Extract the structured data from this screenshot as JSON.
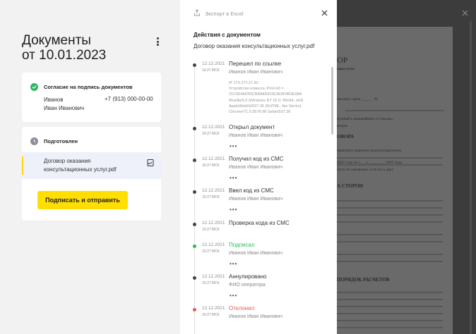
{
  "left": {
    "title_line1": "Документы",
    "title_line2": "от 10.01.2023",
    "agreement_card": {
      "title": "Согласие на подпись документов",
      "signer_last": "Иванов",
      "signer_first": "Иван Иванович",
      "phone": "+7 (913) 000-00-00"
    },
    "prepared_card": {
      "title": "Подготовлен",
      "file_name": "Договор оказания консультационных услуг.pdf",
      "sign_button": "Подписать и отправить"
    }
  },
  "panel": {
    "export_label": "Экспорт в Excel",
    "section_title": "Действия с документом",
    "document_name": "Договор оказания консультационных услуг.pdf",
    "events": [
      {
        "date": "12.12.2021",
        "time": "16:27 МСК",
        "name": "Перешел по ссылке",
        "who": "Иванов Иван Иванович",
        "color": "#444444",
        "meta": [
          "IP 173.272.27.82",
          "Устройство клиента: Print A3 =",
          "21C904AD55CB8A8A922E3E8F8B3E98A",
          "Mozilla/5.0 (Windows NT 10.0; Win64; x64)",
          "AppleWebKit/537.36 (KHTML, like Gecko)",
          "Chrome/71.0.3578.98 Safari/537.36"
        ]
      },
      {
        "date": "12.12.2021",
        "time": "16:27 МСК",
        "name": "Открыл документ",
        "who": "Иванов Иван Иванович",
        "color": "#444444",
        "more": "•••"
      },
      {
        "date": "12.12.2021",
        "time": "16:27 МСК",
        "name": "Получил код из СМС",
        "who": "Иванов Иван Иванович",
        "color": "#444444",
        "more": "•••"
      },
      {
        "date": "12.12.2021",
        "time": "16:27 МСК",
        "name": "Ввел код из СМС",
        "who": "Иванов Иван Иванович",
        "color": "#444444",
        "more": "•••"
      },
      {
        "date": "12.12.2021",
        "time": "16:27 МСК",
        "name": "Проверка кода из СМС",
        "color": "#444444"
      },
      {
        "date": "12.12.2021",
        "time": "16:27 МСК",
        "name": "Подписал",
        "who": "Иванов Иван Иванович",
        "color": "#2db85e",
        "more": "•••"
      },
      {
        "date": "12.12.2021",
        "time": "16:27 МСК",
        "name": "Аннулировано",
        "who": "ФИО оператора",
        "color": "#444444",
        "more": "•••"
      },
      {
        "date": "12.12.2021",
        "time": "16:27 МСК",
        "name": "Отклонил",
        "who": "Иванов Иван Иванович",
        "color": "#e05a4e"
      }
    ]
  },
  "bgdoc": {
    "heading1": "ОР",
    "sub1": "ьных услуг",
    "line_passport": "паспорт серии ______ №",
    "line_org": "нуемый в дальнейшем «Сторона»,",
    "line_pred": "ющем:",
    "heading2": "ОВОРА",
    "line3": "Заказчику комплекс консультационных",
    "line4": "2022 года по «___» ________ 2022 года.",
    "line5": "Акта об оказанных услугах в двух",
    "heading3": "А СТОРОН",
    "heading4": "ПОРЯДОК РАСЧЕТОВ"
  }
}
